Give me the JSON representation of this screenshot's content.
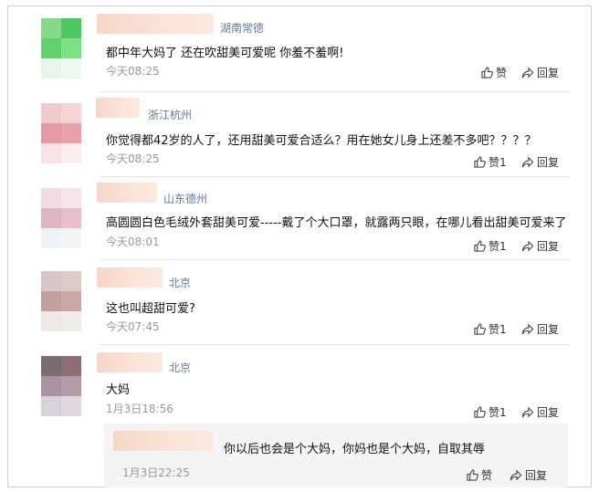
{
  "comments": [
    {
      "location": "湖南常德",
      "text": "都中年大妈了 还在吹甜美可爱呢 你羞不羞啊!",
      "time": "今天08:25",
      "like": "赞",
      "reply": "回复",
      "avatar_colors": [
        "#86d98a",
        "#4fc761",
        "#61d26c",
        "#7ee087",
        "#e8f6ea",
        "#eef9f0"
      ]
    },
    {
      "location": "浙江杭州",
      "text": "你觉得都42岁的人了，还用甜美可爱合适么？用在她女儿身上还差不多吧？？？？",
      "time": "今天08:25",
      "like": "赞1",
      "reply": "回复",
      "avatar_colors": [
        "#f2c9cc",
        "#f5d3d6",
        "#e49aa0",
        "#e8a3a8",
        "#f8e2e4",
        "#fbeeef"
      ]
    },
    {
      "location": "山东德州",
      "text": "高圆圆白色毛绒外套甜美可爱-----戴了个大口罩，就露两只眼，在哪儿看出甜美可爱来了",
      "time": "今天08:01",
      "like": "赞1",
      "reply": "回复",
      "avatar_colors": [
        "#f1dce3",
        "#f5e4ea",
        "#e1b4c1",
        "#e6bfca",
        "#eef1f3",
        "#f2f4f6"
      ]
    },
    {
      "location": "北京",
      "text": "这也叫超甜可爱?",
      "time": "今天07:45",
      "like": "赞1",
      "reply": "回复",
      "avatar_colors": [
        "#d7c6c3",
        "#ddcbc8",
        "#c49f9d",
        "#c9a9a6",
        "#ede8e7",
        "#f1ecec"
      ]
    },
    {
      "location": "北京",
      "text": "大妈",
      "time": "1月3日18:56",
      "like": "赞1",
      "reply": "回复",
      "avatar_colors": [
        "#7a6d72",
        "#8b6f76",
        "#a993a0",
        "#b49ba8",
        "#d8d2d7",
        "#dfd9dd"
      ]
    }
  ],
  "reply": {
    "text": "你以后也会是个大妈，你妈也是个大妈，自取其辱",
    "time": "1月3日22:25",
    "like": "赞",
    "reply": "回复"
  }
}
